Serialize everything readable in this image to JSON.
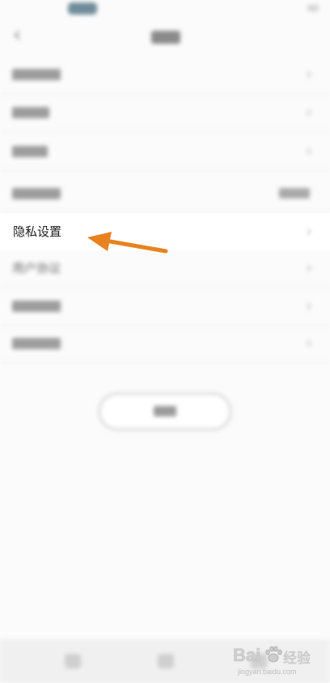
{
  "list": {
    "privacy_label": "隐私设置",
    "user_agreement_label": "用户协议"
  },
  "annotation": {
    "arrow_color": "#e8821e"
  },
  "watermark": {
    "logo_text": "Bai",
    "logo_cn": "经验",
    "url": "jingyan.baidu.com"
  },
  "colors": {
    "background": "#fbfbfb",
    "row_highlight": "#ffffff",
    "text_primary": "#1f1f1f"
  }
}
